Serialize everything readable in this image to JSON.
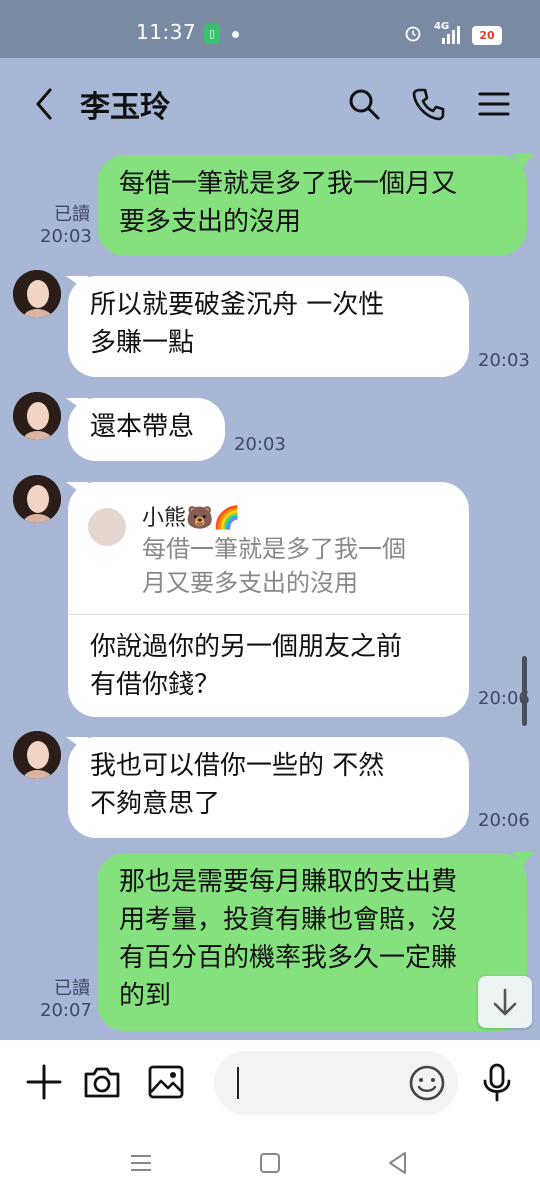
{
  "status_bar": {
    "time": "11:37",
    "network": "4G",
    "battery": "20"
  },
  "header": {
    "title": "李玉玲"
  },
  "messages": [
    {
      "id": "m1",
      "sender": "me",
      "text": "每借一筆就是多了我一個月又\n要多支出的沒用",
      "read": "已讀",
      "time": "20:03"
    },
    {
      "id": "m2",
      "sender": "them",
      "text": "所以就要破釜沉舟  一次性\n多賺一點",
      "time": "20:03"
    },
    {
      "id": "m3",
      "sender": "them",
      "text": "還本帶息",
      "time": "20:03"
    },
    {
      "id": "m4",
      "sender": "them",
      "reply_name": "小熊🐻🌈",
      "reply_quote": "每借一筆就是多了我一個\n月又要多支出的沒用",
      "text": "你說過你的另一個朋友之前\n有借你錢？",
      "time": "20:06"
    },
    {
      "id": "m5",
      "sender": "them",
      "text": "我也可以借你一些的  不然\n不夠意思了",
      "time": "20:06"
    },
    {
      "id": "m6",
      "sender": "me",
      "text": "那也是需要每月賺取的支出費\n用考量，投資有賺也會賠，沒\n有百分百的機率我多久一定賺\n的到",
      "read": "已讀",
      "time": "20:07"
    }
  ],
  "input": {
    "placeholder": "",
    "value": ""
  },
  "colors": {
    "chat_bg": "#a9b7d6",
    "my_bubble": "#85e07e",
    "their_bubble": "#ffffff"
  },
  "icons": [
    "back-icon",
    "search-icon",
    "phone-icon",
    "menu-icon",
    "plus-icon",
    "camera-icon",
    "image-icon",
    "emoji-icon",
    "mic-icon",
    "scroll-down-icon"
  ]
}
